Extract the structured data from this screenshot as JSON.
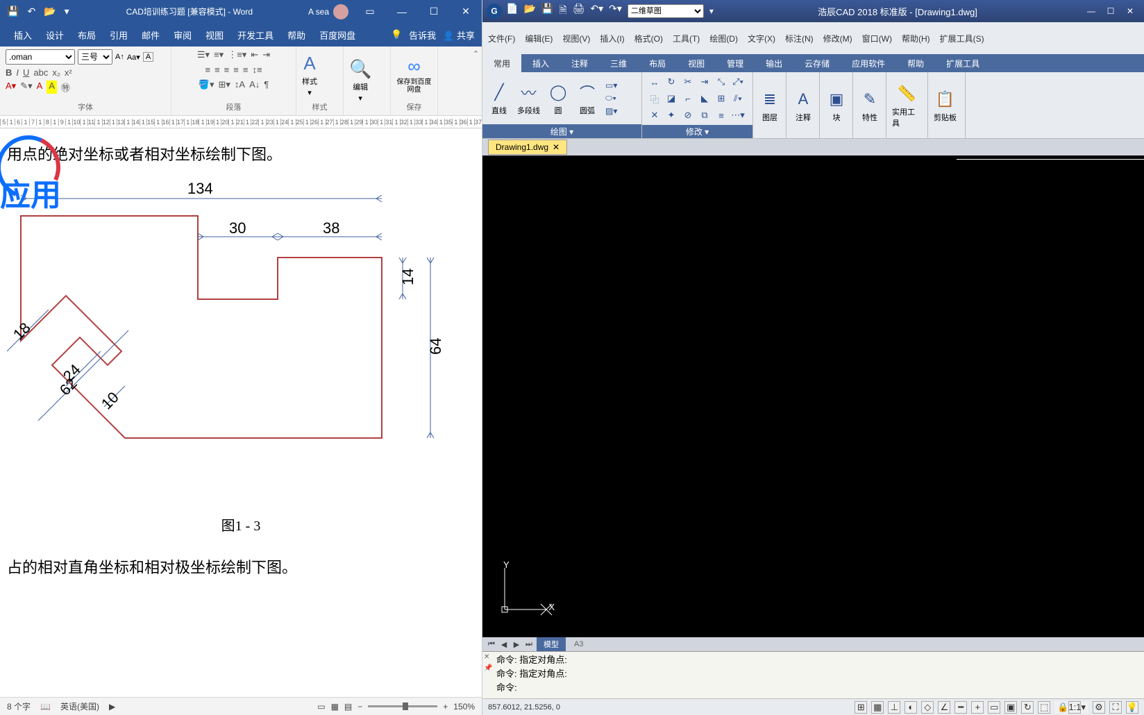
{
  "word": {
    "title": "CAD培训练习题 [兼容模式] - Word",
    "user": "A sea",
    "tabs": [
      "插入",
      "设计",
      "布局",
      "引用",
      "邮件",
      "审阅",
      "视图",
      "开发工具",
      "帮助",
      "百度网盘"
    ],
    "tell_me": "告诉我",
    "share": "共享",
    "font_name": ".oman",
    "font_size": "三号",
    "group_font": "字体",
    "group_para": "段落",
    "group_style": "样式",
    "style_btn": "样式",
    "edit_btn": "编辑",
    "save_btn": "保存到百度网盘",
    "save_group": "保存",
    "ruler": [
      "5",
      "1",
      "6",
      "1",
      "7",
      "1",
      "8",
      "1",
      "9",
      "1",
      "10",
      "1",
      "11",
      "1",
      "12",
      "1",
      "13",
      "1",
      "14",
      "1",
      "15",
      "1",
      "16",
      "1",
      "17",
      "1",
      "18",
      "1",
      "19",
      "1",
      "20",
      "1",
      "21",
      "1",
      "22",
      "1",
      "23",
      "1",
      "24",
      "1",
      "25",
      "1",
      "26",
      "1",
      "27",
      "1",
      "28",
      "1",
      "29",
      "1",
      "30",
      "1",
      "31",
      "1",
      "32",
      "1",
      "33",
      "1",
      "34",
      "1",
      "35",
      "1",
      "36",
      "1",
      "37"
    ],
    "doc_line1": "用点的绝对坐标或者相对坐标绘制下图。",
    "doc_line2": "占的相对直角坐标和相对极坐标绘制下图。",
    "fig_caption": "图1 - 3",
    "dims": {
      "d134": "134",
      "d30": "30",
      "d38": "38",
      "d14": "14",
      "d64": "64",
      "d18": "18",
      "d24": "24",
      "d62": "62",
      "d10": "10"
    },
    "status": {
      "words": "8 个字",
      "lang": "英语(美国)",
      "zoom": "150%"
    }
  },
  "cad": {
    "workspace": "二维草图",
    "title": "浩辰CAD 2018 标准版",
    "file": "[Drawing1.dwg]",
    "menus": [
      "文件(F)",
      "编辑(E)",
      "视图(V)",
      "插入(I)",
      "格式(O)",
      "工具(T)",
      "绘图(D)",
      "文字(X)",
      "标注(N)",
      "修改(M)",
      "窗口(W)",
      "帮助(H)",
      "扩展工具(S)"
    ],
    "ribbon_tabs": [
      "常用",
      "插入",
      "注释",
      "三维",
      "布局",
      "视图",
      "管理",
      "输出",
      "云存储",
      "应用软件",
      "帮助",
      "扩展工具"
    ],
    "draw": {
      "line": "直线",
      "pline": "多段线",
      "circle": "圆",
      "arc": "圆弧"
    },
    "group_draw": "绘图 ▾",
    "group_modify": "修改 ▾",
    "layer": "图层",
    "annotate": "注释",
    "block": "块",
    "props": "特性",
    "utils": "实用工具",
    "clip": "剪贴板",
    "drawing_tab": "Drawing1.dwg",
    "model_tab": "模型",
    "a3_tab": "A3",
    "ucs_y": "Y",
    "ucs_x": "X",
    "cmd1": "命令: 指定对角点:",
    "cmd2": "命令: 指定对角点:",
    "cmd3": "命令:",
    "coords": "857.6012, 21.5256, 0",
    "scale": "1:1"
  },
  "logo": "应用"
}
